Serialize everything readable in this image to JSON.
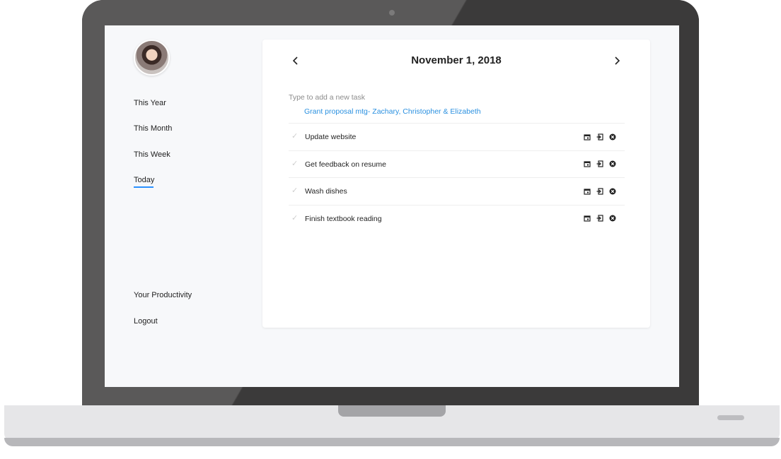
{
  "sidebar": {
    "avatar_alt": "",
    "items": [
      {
        "label": "This Year"
      },
      {
        "label": "This Month"
      },
      {
        "label": "This Week"
      },
      {
        "label": "Today"
      }
    ],
    "bottom_items": [
      {
        "label": "Your Productivity"
      },
      {
        "label": "Logout"
      }
    ]
  },
  "main": {
    "date_title": "November 1, 2018",
    "prev_icon": "chevron-left-icon",
    "next_icon": "chevron-right-icon",
    "new_task_placeholder": "Type to add a new task",
    "suggestion": "Grant proposal mtg- Zachary, Christopher & Elizabeth",
    "tasks": [
      {
        "label": "Update website"
      },
      {
        "label": "Get feedback on resume"
      },
      {
        "label": "Wash dishes"
      },
      {
        "label": "Finish textbook reading"
      }
    ],
    "task_action_icons": [
      "calendar-icon",
      "move-icon",
      "delete-icon"
    ]
  },
  "colors": {
    "accent": "#2a90ff",
    "link": "#2a90e0",
    "bezel": "#3b3a3a",
    "screen_bg": "#f7f8fa"
  }
}
